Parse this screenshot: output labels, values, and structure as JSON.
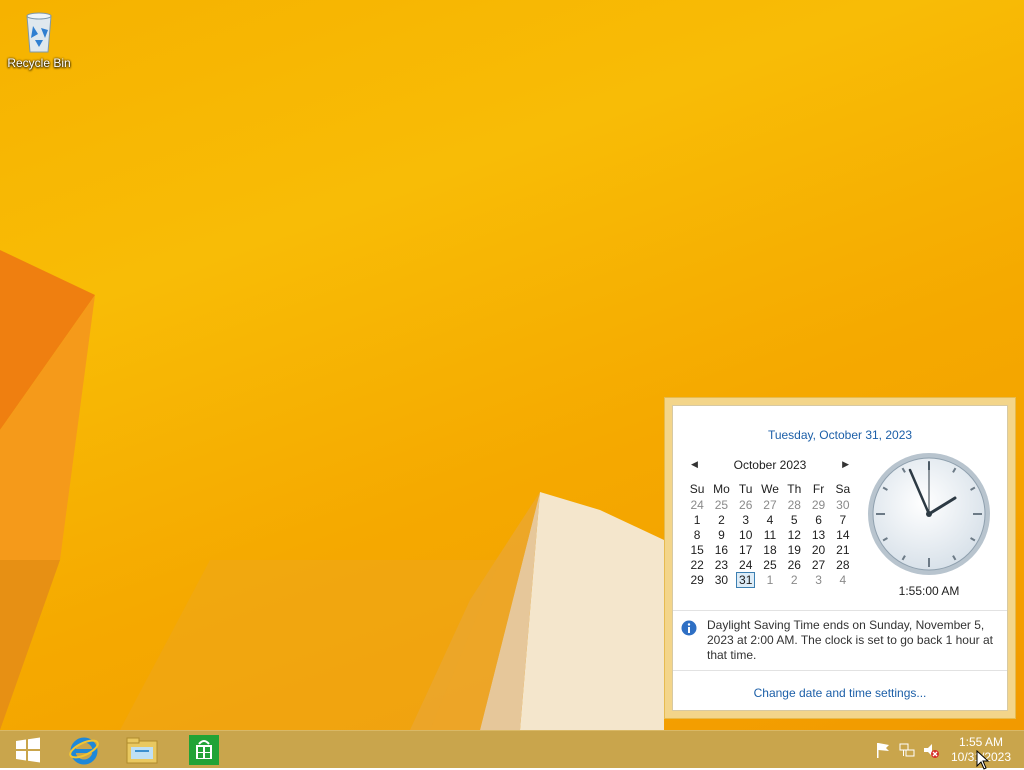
{
  "desktop": {
    "recycle_bin_label": "Recycle Bin"
  },
  "calendar_popup": {
    "long_date": "Tuesday, October 31, 2023",
    "month_title": "October 2023",
    "weekdays": [
      "Su",
      "Mo",
      "Tu",
      "We",
      "Th",
      "Fr",
      "Sa"
    ],
    "weeks": [
      [
        "24",
        "25",
        "26",
        "27",
        "28",
        "29",
        "30"
      ],
      [
        "1",
        "2",
        "3",
        "4",
        "5",
        "6",
        "7"
      ],
      [
        "8",
        "9",
        "10",
        "11",
        "12",
        "13",
        "14"
      ],
      [
        "15",
        "16",
        "17",
        "18",
        "19",
        "20",
        "21"
      ],
      [
        "22",
        "23",
        "24",
        "25",
        "26",
        "27",
        "28"
      ],
      [
        "29",
        "30",
        "31",
        "1",
        "2",
        "3",
        "4"
      ]
    ],
    "today": "31",
    "clock_time": "1:55:00 AM",
    "dst_notice": "Daylight Saving Time ends on Sunday, November 5, 2023 at 2:00 AM. The clock is set to go back 1 hour at that time.",
    "settings_link": "Change date and time settings..."
  },
  "taskbar": {
    "time": "1:55 AM",
    "date": "10/31/2023",
    "pinned": [
      "start-button",
      "internet-explorer-icon",
      "file-explorer-icon",
      "store-icon"
    ],
    "tray": [
      "action-center-flag-icon",
      "network-icon",
      "volume-muted-icon"
    ]
  },
  "colors": {
    "accent": "#f6b200",
    "link": "#1c5fa8",
    "taskbar": "#c9a54c"
  }
}
